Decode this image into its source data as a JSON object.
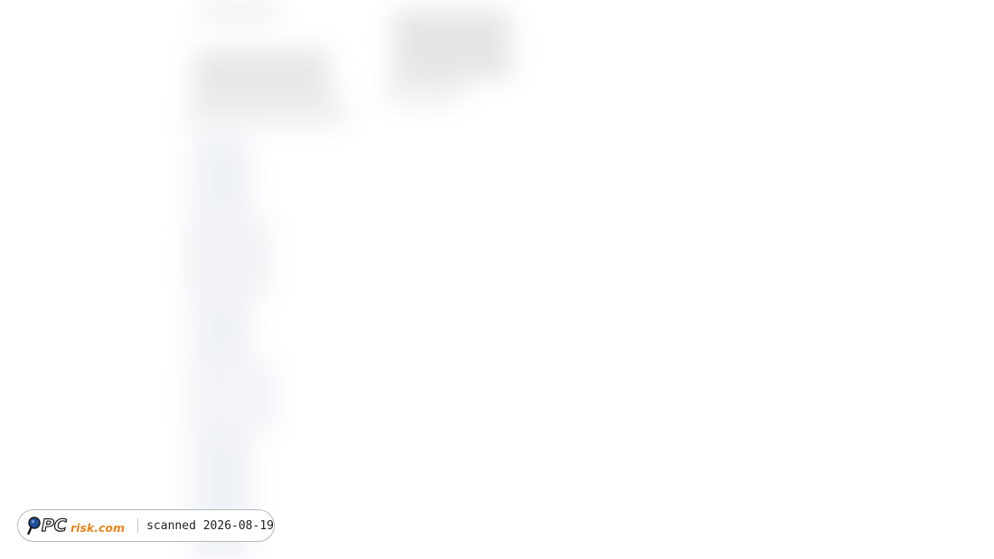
{
  "watermark": {
    "logo_text": "PCrisk.com",
    "scan_text": "scanned 2026-08-19"
  },
  "colors": {
    "logo_blue": "#1f4e9c",
    "logo_orange": "#e8861a",
    "logo_dark": "#1a1a1a"
  }
}
